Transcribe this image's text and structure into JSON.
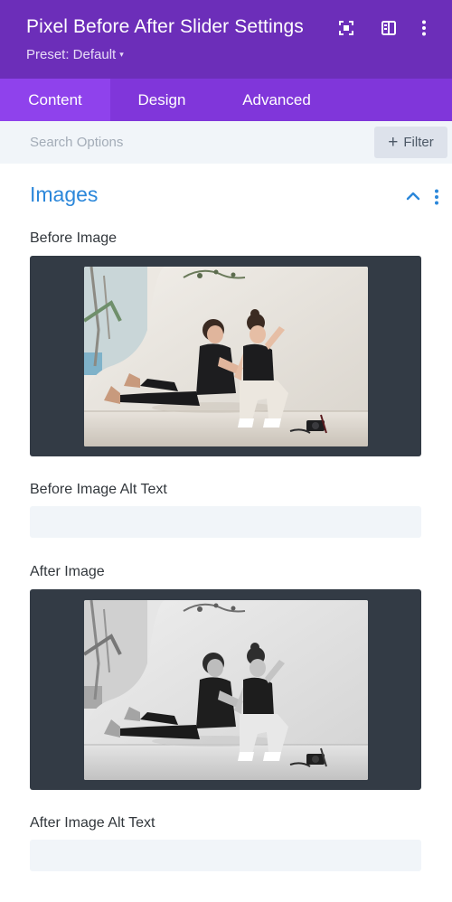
{
  "header": {
    "title": "Pixel Before After Slider Settings",
    "preset_label": "Preset: Default",
    "caret": "▾",
    "icons": [
      "expand-icon",
      "split-view-icon",
      "more-vertical-icon"
    ]
  },
  "tabs": [
    {
      "label": "Content",
      "active": true
    },
    {
      "label": "Design",
      "active": false
    },
    {
      "label": "Advanced",
      "active": false
    }
  ],
  "search": {
    "placeholder": "Search Options",
    "value": "",
    "filter_label": "Filter",
    "filter_icon": "+"
  },
  "section": {
    "title": "Images",
    "icons": [
      "chevron-up-icon",
      "more-vertical-icon"
    ]
  },
  "fields": {
    "before_image_label": "Before Image",
    "before_alt_label": "Before Image Alt Text",
    "before_alt_value": "",
    "after_image_label": "After Image",
    "after_alt_label": "After Image Alt Text",
    "after_alt_value": ""
  },
  "colors": {
    "header_bg": "#6c2eb9",
    "tabs_bg": "#8036da",
    "active_tab_bg": "#8f42ec",
    "section_title": "#2b87da",
    "image_box_bg": "#333b45",
    "field_bg": "#f1f5f9"
  }
}
